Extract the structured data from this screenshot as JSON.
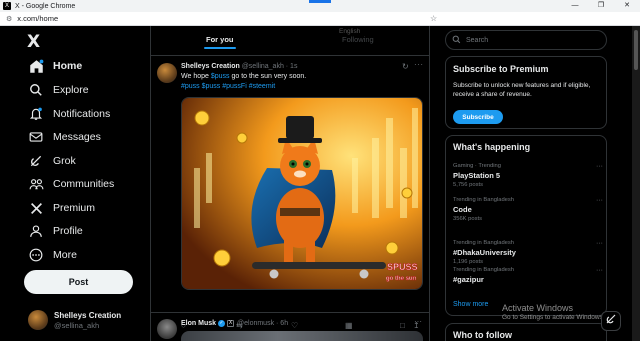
{
  "browser": {
    "window_title": "X - Google Chrome",
    "url": "x.com/home",
    "favicon": "X"
  },
  "nav": {
    "logo": "X",
    "items": [
      {
        "label": "Home",
        "icon": "home-icon"
      },
      {
        "label": "Explore",
        "icon": "search-icon"
      },
      {
        "label": "Notifications",
        "icon": "bell-icon"
      },
      {
        "label": "Messages",
        "icon": "envelope-icon"
      },
      {
        "label": "Grok",
        "icon": "grok-icon"
      },
      {
        "label": "Communities",
        "icon": "people-icon"
      },
      {
        "label": "Premium",
        "icon": "x-logo-icon"
      },
      {
        "label": "Profile",
        "icon": "person-icon"
      },
      {
        "label": "More",
        "icon": "more-circle-icon"
      }
    ],
    "post_label": "Post",
    "account": {
      "name": "Shelleys Creation",
      "handle": "@sellina_akh"
    }
  },
  "timeline": {
    "tabs": {
      "active": "For you",
      "other": "Following"
    },
    "ghost_text": "English"
  },
  "tweet1": {
    "name": "Shelleys Creation",
    "handle_time": "@sellina_akh · 1s",
    "text_prefix": "We hope ",
    "cashtag": "$puss",
    "text_suffix": " go to the sun very soon.",
    "hashtags": "#puss $puss #pussFi #steemit",
    "image_text_1": "SPUSS",
    "image_text_2": "go the sun"
  },
  "tweet2": {
    "name": "Elon Musk",
    "handle_time": "@elonmusk · 6h"
  },
  "sidebar": {
    "search_placeholder": "Search",
    "premium": {
      "title": "Subscribe to Premium",
      "text": "Subscribe to unlock new features and if eligible, receive a share of revenue.",
      "button": "Subscribe"
    },
    "happening": {
      "title": "What's happening",
      "trends": [
        {
          "context": "Gaming · Trending",
          "title": "PlayStation 5",
          "count": "5,756 posts"
        },
        {
          "context": "Trending in Bangladesh",
          "title": "Code",
          "count": "356K posts"
        },
        {
          "context": "Trending in Bangladesh",
          "title": "#DhakaUniversity",
          "count": "1,196 posts"
        },
        {
          "context": "Trending in Bangladesh",
          "title": "#gazipur",
          "count": ""
        }
      ],
      "show_more": "Show more"
    },
    "who_to_follow": "Who to follow"
  },
  "watermark": {
    "line1": "Activate Windows",
    "line2": "Go to Settings to activate Windows."
  },
  "colors": {
    "accent": "#1d9bf0",
    "background": "#000000",
    "border": "#2f3336",
    "muted": "#71767b"
  }
}
